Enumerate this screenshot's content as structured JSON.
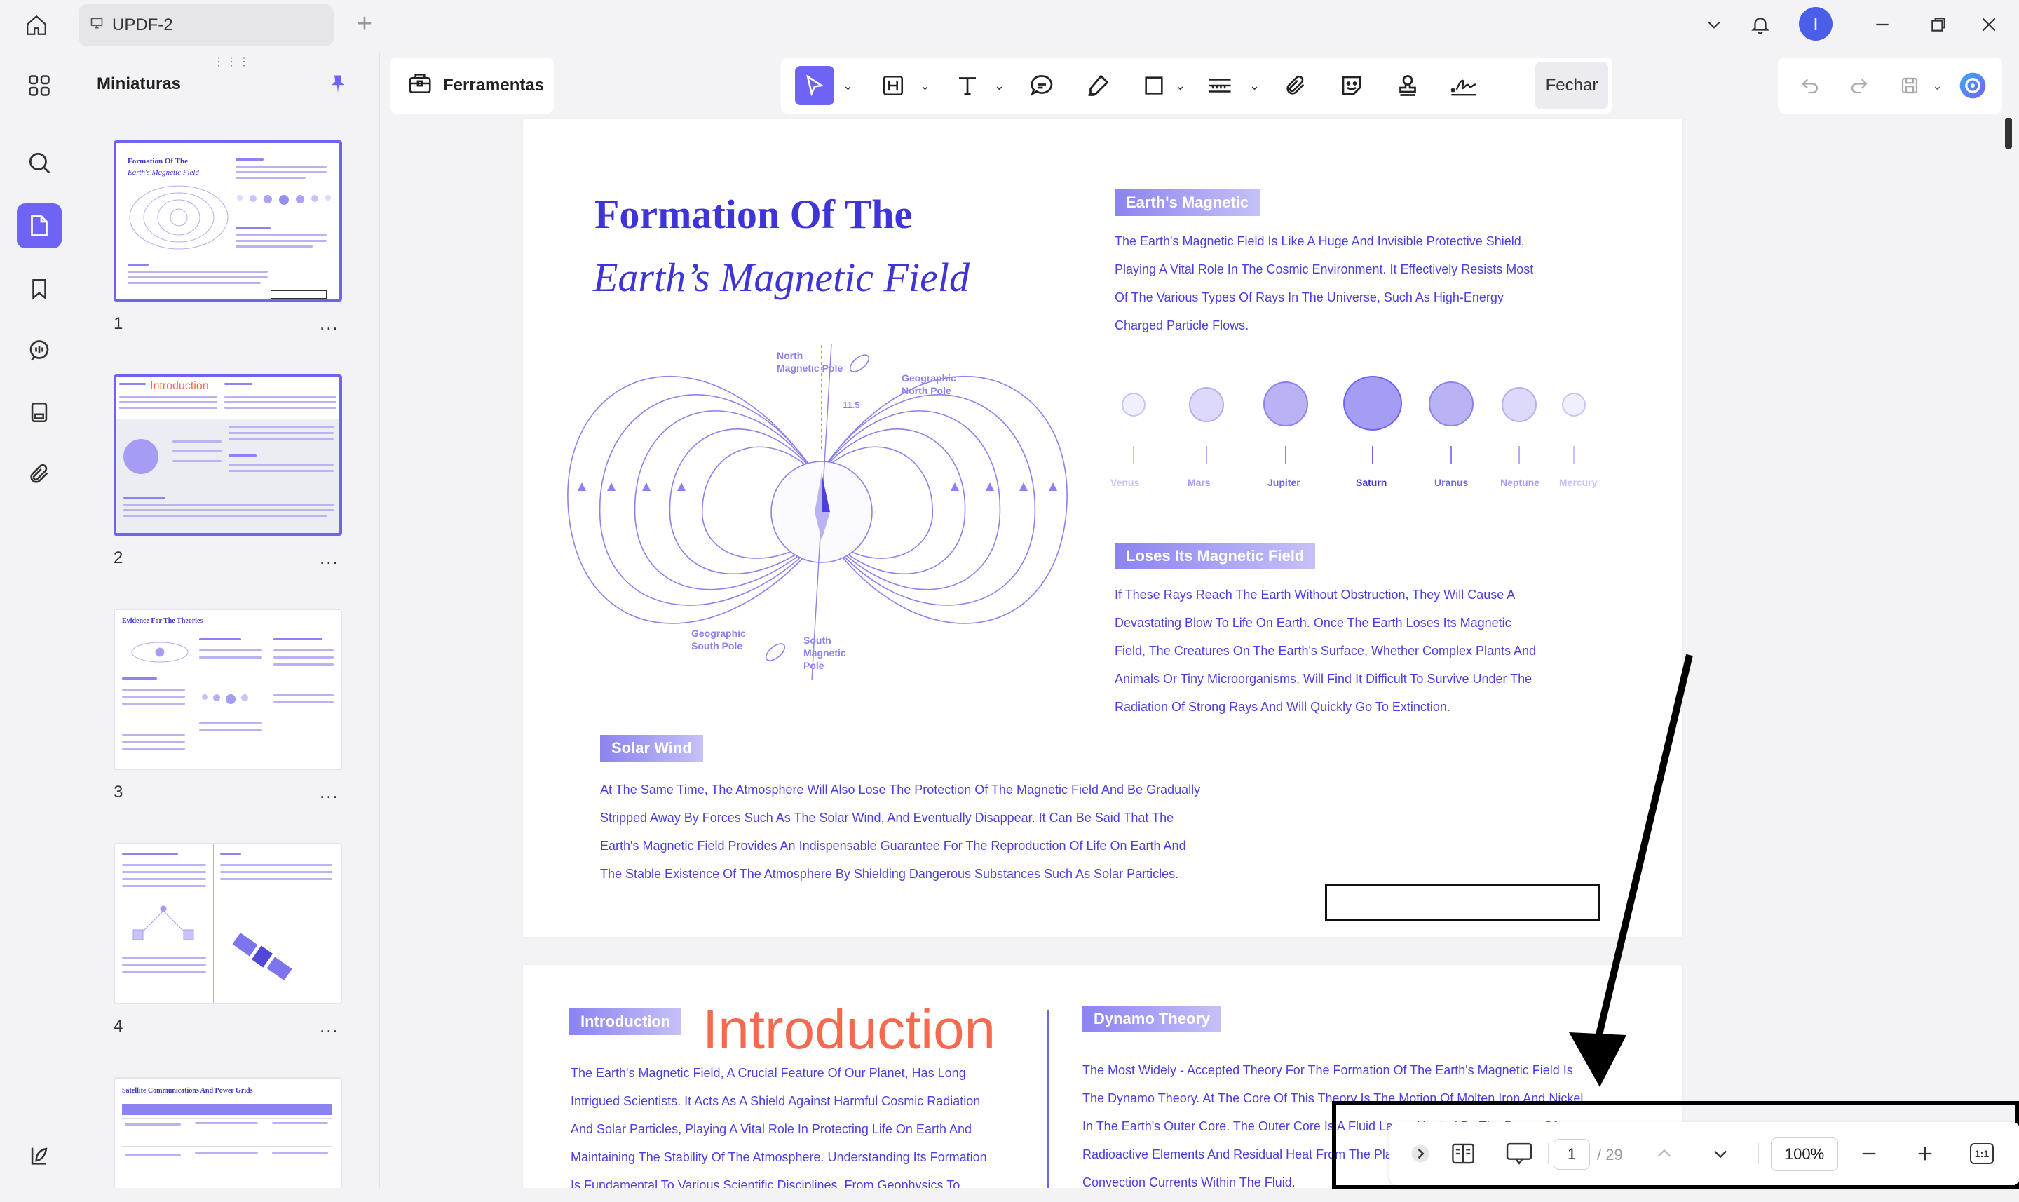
{
  "app": {
    "tab_title": "UPDF-2",
    "avatar_initial": "I",
    "accent": "#6f63f5"
  },
  "icons": [
    "home-icon",
    "monitor-icon",
    "plus-icon",
    "chevron-down-icon",
    "bell-icon",
    "minimize-icon",
    "restore-icon",
    "close-icon",
    "grid-icon",
    "search-icon",
    "pages-icon",
    "bookmark-icon",
    "comment-icon",
    "form-icon",
    "attachment-icon",
    "layers-icon",
    "pin-icon",
    "toolbox-icon",
    "cursor-icon",
    "heading-icon",
    "text-icon",
    "chat-icon",
    "highlighter-icon",
    "rectangle-icon",
    "measure-icon",
    "clip-icon",
    "sticker-icon",
    "stamp-icon",
    "signature-icon",
    "undo-icon",
    "redo-icon",
    "save-icon",
    "ai-icon"
  ],
  "thumbnails": {
    "title": "Miniaturas",
    "pages": [
      {
        "num": "1",
        "title": "Formation Of The",
        "subtitle": "Earth's Magnetic Field"
      },
      {
        "num": "2",
        "title": "Introduction"
      },
      {
        "num": "3",
        "title": "Evidence For The Theories"
      },
      {
        "num": "4",
        "title": ""
      },
      {
        "num": "",
        "title": "Satellite Communications And Power Grids"
      }
    ],
    "more": "..."
  },
  "toolbar": {
    "tools_label": "Ferramentas",
    "close_label": "Fechar"
  },
  "page1": {
    "title_line1": "Formation Of The",
    "title_line2": "Earth’s Magnetic Field",
    "diagram": {
      "north_magnetic": "North\nMagnetic Pole",
      "geographic_north": "Geographic\nNorth Pole",
      "angle": "11.5",
      "geographic_south": "Geographic\nSouth Pole",
      "south_magnetic": "South\nMagnetic\nPole"
    },
    "section1": {
      "tag": "Earth's Magnetic",
      "lines": [
        "The Earth's Magnetic Field Is Like A Huge And Invisible Protective Shield,",
        "Playing A Vital Role In The Cosmic Environment. It Effectively Resists Most",
        "Of The Various Types Of Rays In The Universe, Such As High-Energy",
        "Charged Particle Flows."
      ]
    },
    "planets": [
      "Venus",
      "Mars",
      "Jupiter",
      "Saturn",
      "Uranus",
      "Neptune",
      "Mercury"
    ],
    "section2": {
      "tag": "Loses Its Magnetic Field",
      "lines": [
        "If These Rays Reach The Earth Without Obstruction, They Will Cause A",
        "Devastating Blow To Life On Earth. Once The Earth Loses Its Magnetic",
        "Field, The Creatures On The Earth's Surface, Whether Complex Plants And",
        "Animals Or Tiny Microorganisms, Will Find It Difficult To Survive Under The",
        "Radiation Of Strong Rays And Will Quickly Go To Extinction."
      ]
    },
    "section3": {
      "tag": "Solar Wind",
      "lines": [
        "At The Same Time, The Atmosphere Will Also Lose The Protection Of The Magnetic Field And Be Gradually",
        "Stripped Away By Forces Such As The Solar Wind, And Eventually Disappear. It Can Be Said That The",
        "Earth's Magnetic Field Provides An Indispensable Guarantee For The Reproduction Of Life On Earth And",
        "The Stable Existence Of The Atmosphere By Shielding Dangerous Substances Such As Solar Particles."
      ]
    }
  },
  "page2": {
    "tag": "Introduction",
    "big_title": "Introduction",
    "left_lines": [
      "The Earth's Magnetic Field, A Crucial Feature Of Our Planet, Has Long",
      "Intrigued Scientists. It Acts As A Shield Against Harmful Cosmic Radiation",
      "And Solar Particles, Playing A Vital Role In Protecting Life On Earth And",
      "Maintaining The Stability Of The Atmosphere. Understanding Its Formation",
      "Is Fundamental To Various Scientific Disciplines, From Geophysics To"
    ],
    "right_tag": "Dynamo Theory",
    "right_lines": [
      "The Most Widely - Accepted Theory For The Formation Of The Earth's Magnetic Field Is",
      "The Dynamo Theory. At The Core Of This Theory Is The Motion Of Molten Iron And Nickel",
      "In The Earth's Outer Core. The Outer Core Is A Fluid Layer, Heated By The Decay Of",
      "Radioactive Elements And Residual Heat From The Planet's Formation. This Heat Causes",
      "Convection Currents Within The Fluid."
    ]
  },
  "nav": {
    "current_page": "1",
    "total_pages": "/ 29",
    "zoom": "100%",
    "fit_label": "1:1"
  }
}
